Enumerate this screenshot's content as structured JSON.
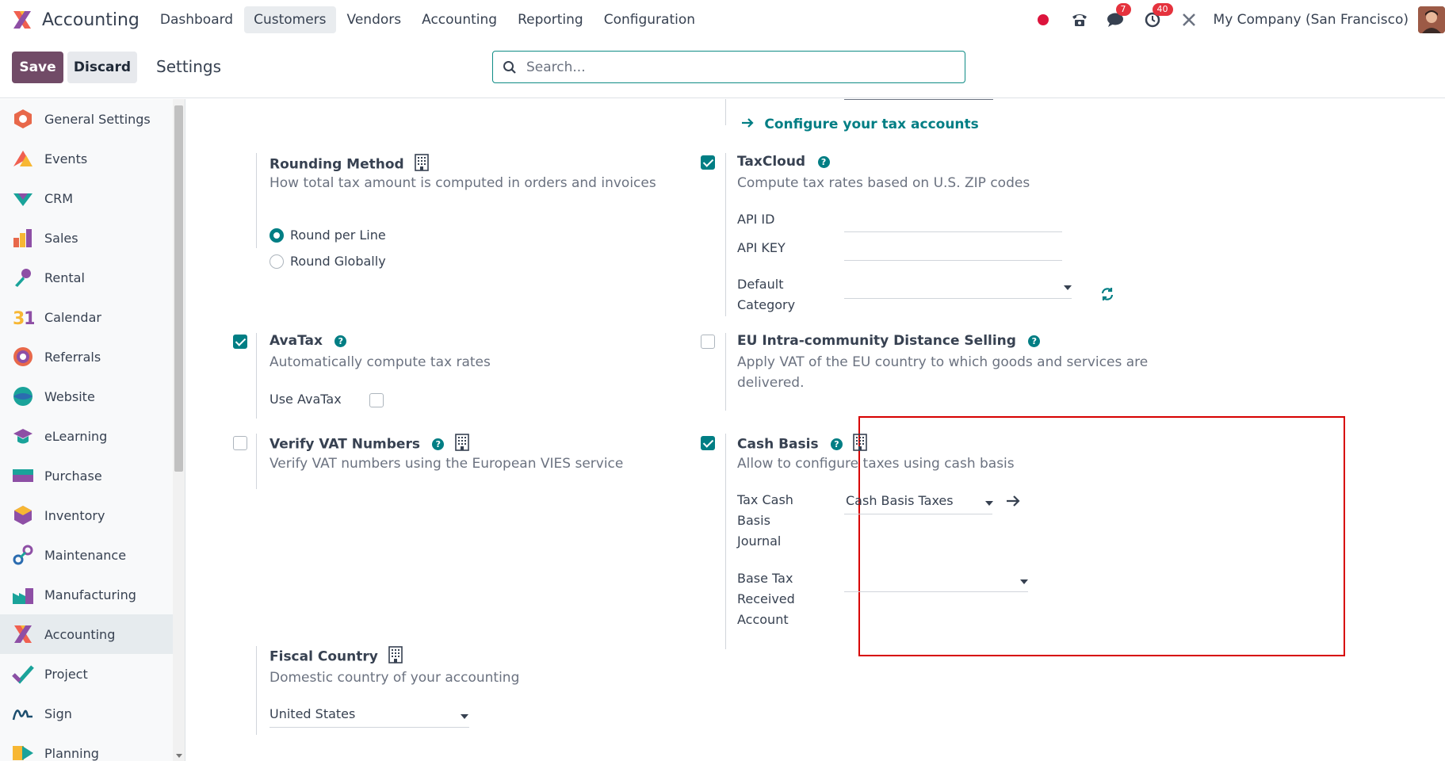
{
  "navbar": {
    "app_name": "Accounting",
    "menu": [
      "Dashboard",
      "Customers",
      "Vendors",
      "Accounting",
      "Reporting",
      "Configuration"
    ],
    "active_menu": "Customers",
    "messages_count": "7",
    "activities_count": "40",
    "company": "My Company (San Francisco)"
  },
  "control": {
    "save_label": "Save",
    "discard_label": "Discard",
    "title": "Settings",
    "search_placeholder": "Search..."
  },
  "sidebar": {
    "items": [
      {
        "label": "General Settings",
        "icon": "general-settings-icon"
      },
      {
        "label": "Events",
        "icon": "events-icon"
      },
      {
        "label": "CRM",
        "icon": "crm-icon"
      },
      {
        "label": "Sales",
        "icon": "sales-icon"
      },
      {
        "label": "Rental",
        "icon": "rental-icon"
      },
      {
        "label": "Calendar",
        "icon": "calendar-icon"
      },
      {
        "label": "Referrals",
        "icon": "referrals-icon"
      },
      {
        "label": "Website",
        "icon": "website-icon"
      },
      {
        "label": "eLearning",
        "icon": "elearning-icon"
      },
      {
        "label": "Purchase",
        "icon": "purchase-icon"
      },
      {
        "label": "Inventory",
        "icon": "inventory-icon"
      },
      {
        "label": "Maintenance",
        "icon": "maintenance-icon"
      },
      {
        "label": "Manufacturing",
        "icon": "manufacturing-icon"
      },
      {
        "label": "Accounting",
        "icon": "accounting-icon",
        "active": true
      },
      {
        "label": "Project",
        "icon": "project-icon"
      },
      {
        "label": "Sign",
        "icon": "sign-icon"
      },
      {
        "label": "Planning",
        "icon": "planning-icon"
      }
    ]
  },
  "settings": {
    "configure_tax_link": "Configure your tax accounts",
    "rounding": {
      "title": "Rounding Method",
      "desc": "How total tax amount is computed in orders and invoices",
      "options": [
        "Round per Line",
        "Round Globally"
      ],
      "selected": "Round per Line"
    },
    "taxcloud": {
      "title": "TaxCloud",
      "desc": "Compute tax rates based on U.S. ZIP codes",
      "checked": true,
      "api_id_label": "API ID",
      "api_key_label": "API KEY",
      "default_category_label_1": "Default",
      "default_category_label_2": "Category"
    },
    "avatax": {
      "title": "AvaTax",
      "desc": "Automatically compute tax rates",
      "checked": true,
      "use_label": "Use AvaTax"
    },
    "eu_distance": {
      "title": "EU Intra-community Distance Selling",
      "desc_1": "Apply VAT of the EU country to which goods and services are",
      "desc_2": "delivered.",
      "checked": false
    },
    "vat": {
      "title": "Verify VAT Numbers",
      "desc": "Verify VAT numbers using the European VIES service",
      "checked": false
    },
    "cash_basis": {
      "title": "Cash Basis",
      "desc": "Allow to configure taxes using cash basis",
      "checked": true,
      "journal_label": [
        "Tax Cash",
        "Basis",
        "Journal"
      ],
      "journal_value": "Cash Basis Taxes",
      "base_account_label": [
        "Base Tax",
        "Received",
        "Account"
      ],
      "base_account_value": ""
    },
    "fiscal_country": {
      "title": "Fiscal Country",
      "desc": "Domestic country of your accounting",
      "value": "United States"
    }
  },
  "colors": {
    "primary": "#714b67",
    "teal": "#017e84",
    "highlight": "#d70000"
  }
}
